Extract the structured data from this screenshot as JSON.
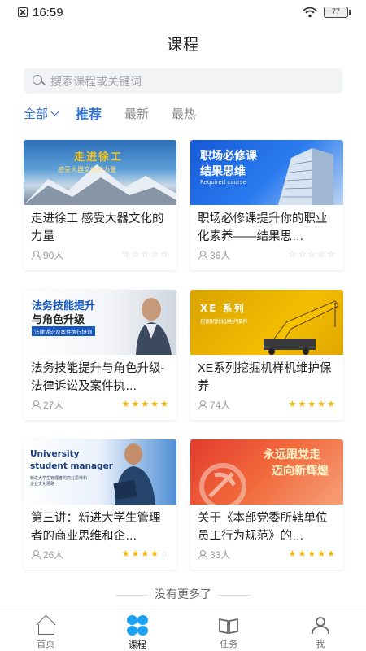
{
  "status_bar": {
    "time": "16:59",
    "battery": "77"
  },
  "header": {
    "title": "课程"
  },
  "search": {
    "placeholder": "搜索课程或关键词"
  },
  "filters": {
    "all": "全部",
    "tabs": [
      "推荐",
      "最新",
      "最热"
    ],
    "active": "推荐"
  },
  "courses": [
    {
      "title": "走进徐工 感受大器文化的力量",
      "count": "90人",
      "rating": 0,
      "thumb": {
        "line1": "走进徐工",
        "line2": "感受大器文化的力量"
      }
    },
    {
      "title": "职场必修课提升你的职业化素养——结果思…",
      "count": "36人",
      "rating": 0,
      "thumb": {
        "line1": "职场必修课",
        "line2": "结果思维",
        "line3": "Required course"
      }
    },
    {
      "title": "法务技能提升与角色升级-法律诉讼及案件执…",
      "count": "27人",
      "rating": 5,
      "thumb": {
        "line1": "法务技能提升",
        "line2": "与角色升级",
        "line3": "法律诉讼及案件执行培训"
      }
    },
    {
      "title": "XE系列挖掘机样机维护保养",
      "count": "74人",
      "rating": 5,
      "thumb": {
        "line1": "XE 系列",
        "line2": "挖掘机样机维护保养"
      }
    },
    {
      "title": "第三讲：新进大学生管理者的商业思维和企…",
      "count": "26人",
      "rating": 4,
      "thumb": {
        "line1": "University",
        "line2": "student manager",
        "line3": "新进大学生管理者的商业思维和企业文化思路"
      }
    },
    {
      "title": "关于《本部党委所辖单位员工行为规范》的…",
      "count": "33人",
      "rating": 5,
      "thumb": {
        "line1": "永远跟党走",
        "line2": "迈向新辉煌"
      }
    }
  ],
  "footer_text": "没有更多了",
  "nav": [
    "首页",
    "课程",
    "任务",
    "我"
  ],
  "colors": {
    "accent": "#2f6fd6",
    "star": "#f4b400",
    "course_icon": "#1da1f2"
  }
}
